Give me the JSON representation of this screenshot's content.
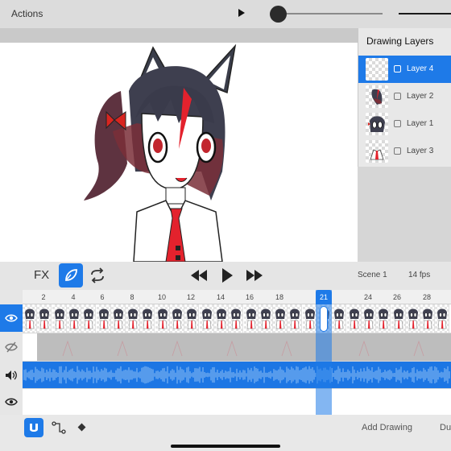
{
  "topbar": {
    "actions_label": "Actions"
  },
  "layers": {
    "title": "Drawing Layers",
    "items": [
      {
        "label": "Layer 4",
        "selected": true
      },
      {
        "label": "Layer 2",
        "selected": false
      },
      {
        "label": "Layer 1",
        "selected": false
      },
      {
        "label": "Layer 3",
        "selected": false
      }
    ]
  },
  "timeline": {
    "fx_label": "FX",
    "scene_label": "Scene 1",
    "fps_label": "14 fps",
    "ticks": [
      "2",
      "4",
      "6",
      "8",
      "10",
      "12",
      "14",
      "16",
      "18",
      "21",
      "24",
      "26",
      "28"
    ],
    "current_frame": "21"
  },
  "bottombar": {
    "add_drawing_label": "Add Drawing",
    "dup_label": "Du"
  },
  "colors": {
    "accent": "#1e7ae8",
    "character_red": "#e3222d"
  },
  "icons": {
    "play": "play-icon",
    "rewind": "rewind-icon",
    "fast_forward": "fast-forward-icon",
    "loop": "loop-icon",
    "brush": "brush-icon",
    "eye": "eye-icon",
    "eye_off": "eye-off-icon",
    "speaker": "speaker-icon",
    "magnet": "magnet-icon",
    "connect": "connect-icon",
    "keyframe": "diamond-icon"
  }
}
